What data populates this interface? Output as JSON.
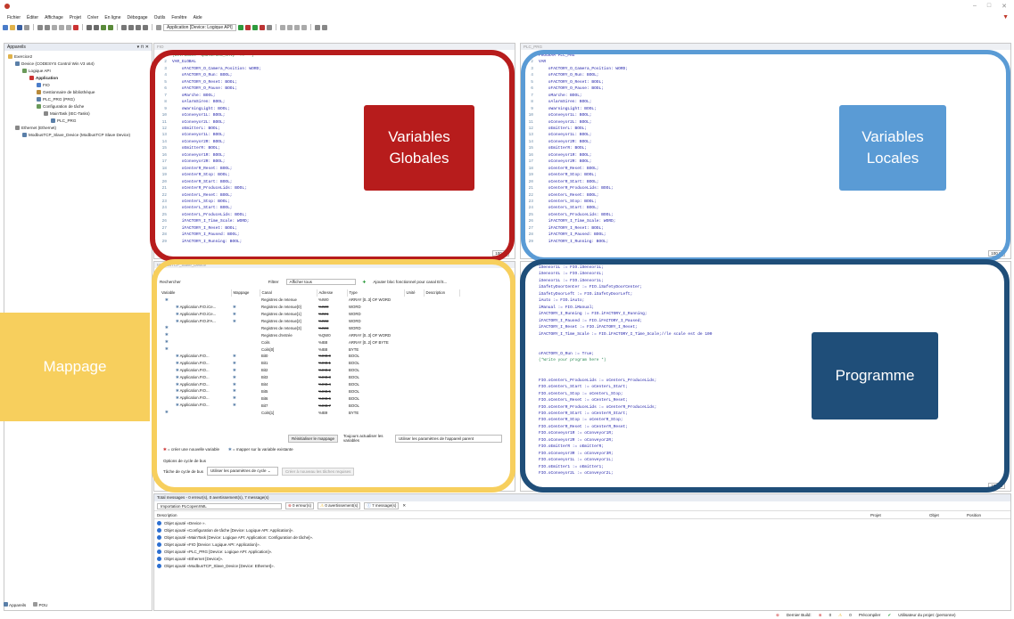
{
  "menu": [
    "Fichier",
    "Éditer",
    "Affichage",
    "Projet",
    "Créer",
    "En ligne",
    "Débogage",
    "Outils",
    "Fenêtre",
    "Aide"
  ],
  "toolbar": {
    "app_combo": "Application [Device: Logique API]"
  },
  "devices": {
    "title": "Appareils",
    "tree": [
      {
        "label": "Exercice2",
        "indent": 0
      },
      {
        "label": "Device (CODESYS Control Win V3 x64)",
        "indent": 1
      },
      {
        "label": "Logique API",
        "indent": 2
      },
      {
        "label": "Application",
        "indent": 3
      },
      {
        "label": "FIO",
        "indent": 4
      },
      {
        "label": "Gestionnaire de bibliothèque",
        "indent": 4
      },
      {
        "label": "PLC_PRG (PRG)",
        "indent": 4
      },
      {
        "label": "Configuration de tâche",
        "indent": 4
      },
      {
        "label": "MainTask (IEC-Tasks)",
        "indent": 5
      },
      {
        "label": "PLC_PRG",
        "indent": 6
      },
      {
        "label": "Ethernet (Ethernet)",
        "indent": 1
      },
      {
        "label": "ModbusTCP_Slave_Device (ModbusTCP Slave Device)",
        "indent": 2
      }
    ],
    "bottom_tabs": [
      "Appareils",
      "POU"
    ]
  },
  "pane_gvl": {
    "tab": "FIO",
    "zoom": "100 %",
    "lines": [
      {
        "n": "1",
        "t": "{attribute 'qualified_only' := ''}",
        "c": true
      },
      {
        "n": "2",
        "t": "VAR_GLOBAL"
      },
      {
        "n": "3",
        "t": "    oFACTORY_O_Camera_Position: WORD;"
      },
      {
        "n": "4",
        "t": "    oFACTORY_O_Run: BOOL;"
      },
      {
        "n": "5",
        "t": "    oFACTORY_O_Reset: BOOL;"
      },
      {
        "n": "6",
        "t": "    oFACTORY_O_Pause: BOOL;"
      },
      {
        "n": "7",
        "t": "    oMarche: BOOL;"
      },
      {
        "n": "8",
        "t": "    oAlarmSiren: BOOL;"
      },
      {
        "n": "9",
        "t": "    oWarningLight: BOOL;"
      },
      {
        "n": "10",
        "t": "    oConveyor1L: BOOL;"
      },
      {
        "n": "11",
        "t": "    oConveyor2L: BOOL;"
      },
      {
        "n": "12",
        "t": "    oEmitterL: BOOL;"
      },
      {
        "n": "13",
        "t": "    oConveyor1L: BOOL;"
      },
      {
        "n": "14",
        "t": "    oConveyor2R: BOOL;"
      },
      {
        "n": "15",
        "t": "    oEmitterR: BOOL;"
      },
      {
        "n": "16",
        "t": "    oConveyor1R: BOOL;"
      },
      {
        "n": "17",
        "t": "    oConveyor2R: BOOL;"
      },
      {
        "n": "18",
        "t": "    oCenterR_Reset: BOOL;"
      },
      {
        "n": "19",
        "t": "    oCenterR_Stop: BOOL;"
      },
      {
        "n": "20",
        "t": "    oCenterR_Start: BOOL;"
      },
      {
        "n": "21",
        "t": "    oCenterR_ProduceLids: BOOL;"
      },
      {
        "n": "22",
        "t": "    oCenterL_Reset: BOOL;"
      },
      {
        "n": "23",
        "t": "    oCenterL_Stop: BOOL;"
      },
      {
        "n": "24",
        "t": "    oCenterL_Start: BOOL;"
      },
      {
        "n": "25",
        "t": "    oCenterL_ProduceLids: BOOL;"
      },
      {
        "n": "26",
        "t": "    iFACTORY_I_Time_Scale: WORD;"
      },
      {
        "n": "27",
        "t": "    iFACTORY_I_Reset: BOOL;"
      },
      {
        "n": "28",
        "t": "    iFACTORY_I_Paused: BOOL;"
      },
      {
        "n": "29",
        "t": "    iFACTORY_I_Running: BOOL;"
      }
    ]
  },
  "pane_prg_vars": {
    "tab": "PLC_PRG",
    "zoom": "100 %",
    "lines": [
      {
        "n": "1",
        "t": "PROGRAM PLC_PRG"
      },
      {
        "n": "2",
        "t": "VAR"
      },
      {
        "n": "3",
        "t": "    oFACTORY_O_Camera_Position: WORD;"
      },
      {
        "n": "4",
        "t": "    oFACTORY_O_Run: BOOL;"
      },
      {
        "n": "5",
        "t": "    oFACTORY_O_Reset: BOOL;"
      },
      {
        "n": "6",
        "t": "    oFACTORY_O_Pause: BOOL;"
      },
      {
        "n": "7",
        "t": "    oMarche: BOOL;"
      },
      {
        "n": "8",
        "t": "    oAlarmSiren: BOOL;"
      },
      {
        "n": "9",
        "t": "    oWarningLight: BOOL;"
      },
      {
        "n": "10",
        "t": "    oConveyor1L: BOOL;"
      },
      {
        "n": "11",
        "t": "    oConveyor2L: BOOL;"
      },
      {
        "n": "12",
        "t": "    oEmitterL: BOOL;"
      },
      {
        "n": "13",
        "t": "    oConveyor1L: BOOL;"
      },
      {
        "n": "14",
        "t": "    oConveyor2R: BOOL;"
      },
      {
        "n": "15",
        "t": "    oEmitterR: BOOL;"
      },
      {
        "n": "16",
        "t": "    oConveyor1R: BOOL;"
      },
      {
        "n": "17",
        "t": "    oConveyor2R: BOOL;"
      },
      {
        "n": "18",
        "t": "    oCenterR_Reset: BOOL;"
      },
      {
        "n": "19",
        "t": "    oCenterR_Stop: BOOL;"
      },
      {
        "n": "20",
        "t": "    oCenterR_Start: BOOL;"
      },
      {
        "n": "21",
        "t": "    oCenterR_ProduceLids: BOOL;"
      },
      {
        "n": "22",
        "t": "    oCenterL_Reset: BOOL;"
      },
      {
        "n": "23",
        "t": "    oCenterL_Stop: BOOL;"
      },
      {
        "n": "24",
        "t": "    oCenterL_Start: BOOL;"
      },
      {
        "n": "25",
        "t": "    oCenterL_ProduceLids: BOOL;"
      },
      {
        "n": "26",
        "t": "    iFACTORY_I_Time_Scale: WORD;"
      },
      {
        "n": "27",
        "t": "    iFACTORY_I_Reset: BOOL;"
      },
      {
        "n": "28",
        "t": "    iFACTORY_I_Paused: BOOL;"
      },
      {
        "n": "29",
        "t": "    iFACTORY_I_Running: BOOL;"
      }
    ]
  },
  "pane_program": {
    "zoom": "100 %",
    "lines": [
      {
        "n": "",
        "t": "iSensor1L := FIO.iSensor1L;"
      },
      {
        "n": "",
        "t": "iSensor4L := FIO.iSensor4L;"
      },
      {
        "n": "",
        "t": "iSensor1L := FIO.iSensor1L;"
      },
      {
        "n": "",
        "t": "iSafetyDoorCenter := FIO.iSafetyDoorCenter;"
      },
      {
        "n": "",
        "t": "iSafetyDoorLeft := FIO.iSafetyDoorLeft;"
      },
      {
        "n": "",
        "t": "iAuto := FIO.iAuto;"
      },
      {
        "n": "",
        "t": "iManual := FIO.iManual;"
      },
      {
        "n": "",
        "t": "iFACTORY_I_Running := FIO.iFACTORY_I_Running;"
      },
      {
        "n": "",
        "t": "iFACTORY_I_Paused := FIO.iFACTORY_I_Paused;"
      },
      {
        "n": "",
        "t": "iFACTORY_I_Reset := FIO.iFACTORY_I_Reset;"
      },
      {
        "n": "",
        "t": "iFACTORY_I_Time_Scale := FIO.iFACTORY_I_Time_Scale;//le scale est de 100"
      },
      {
        "n": "",
        "t": ""
      },
      {
        "n": "",
        "t": ""
      },
      {
        "n": "",
        "t": "oFACTORY_O_Run := True;"
      },
      {
        "n": "",
        "t": "(*Write your program here *)",
        "c": true
      },
      {
        "n": "",
        "t": ""
      },
      {
        "n": "",
        "t": ""
      },
      {
        "n": "",
        "t": "FIO.oCenterL_ProduceLids := oCenterL_ProduceLids;"
      },
      {
        "n": "",
        "t": "FIO.oCenterL_Start := oCenterL_Start;"
      },
      {
        "n": "",
        "t": "FIO.oCenterL_Stop := oCenterL_Stop;"
      },
      {
        "n": "",
        "t": "FIO.oCenterL_Reset := oCenterL_Reset;"
      },
      {
        "n": "",
        "t": "FIO.oCenterR_ProduceLids := oCenterR_ProduceLids;"
      },
      {
        "n": "",
        "t": "FIO.oCenterR_Start := oCenterR_Start;"
      },
      {
        "n": "",
        "t": "FIO.oCenterR_Stop := oCenterR_Stop;"
      },
      {
        "n": "",
        "t": "FIO.oCenterR_Reset := oCenterR_Reset;"
      },
      {
        "n": "",
        "t": "FIO.oConveyor1R := oConveyor1R;"
      },
      {
        "n": "",
        "t": "FIO.oConveyor2R := oConveyor2R;"
      },
      {
        "n": "",
        "t": "FIO.oEmitterR := oEmitterR;"
      },
      {
        "n": "",
        "t": "FIO.oConveyor3R := oConveyor3R;"
      },
      {
        "n": "",
        "t": "FIO.oConveyor1L := oConveyor1L;"
      },
      {
        "n": "",
        "t": "FIO.oEmitter1 := oEmitter1;"
      },
      {
        "n": "",
        "t": "FIO.oConveyor2L := oConveyor2L;"
      }
    ]
  },
  "mapping": {
    "tab": "ModbusTCP_Slave_Device",
    "search_label": "Rechercher",
    "filter_label": "Filtrer",
    "filter_value": "Afficher tous",
    "add_fb": "Ajouter bloc fonctionnel pour canal E/S...",
    "headers": [
      "Variable",
      "Mappage",
      "Canal",
      "Adresse",
      "Type",
      "Unité",
      "Description"
    ],
    "rows": [
      {
        "var": "",
        "canal": "Registres de retenue",
        "addr": "%IW0",
        "type": "ARRAY [0..3] OF WORD",
        "strike": false
      },
      {
        "var": "Application.FIO.iCe...",
        "canal": "Registres de retenue[0]",
        "addr": "%IW0",
        "type": "WORD",
        "strike": true
      },
      {
        "var": "Application.FIO.iCe...",
        "canal": "Registres de retenue[1]",
        "addr": "%IW1",
        "type": "WORD",
        "strike": true
      },
      {
        "var": "Application.FIO.iFA...",
        "canal": "Registres de retenue[2]",
        "addr": "%IW2",
        "type": "WORD",
        "strike": true
      },
      {
        "var": "",
        "canal": "Registres de retenue[3]",
        "addr": "%IW3",
        "type": "WORD",
        "strike": true
      },
      {
        "var": "",
        "canal": "Registres d'entrée",
        "addr": "%QW0",
        "type": "ARRAY [0..3] OF WORD",
        "strike": false
      },
      {
        "var": "",
        "canal": "Coils",
        "addr": "%IB8",
        "type": "ARRAY [0..2] OF BYTE",
        "strike": false
      },
      {
        "var": "",
        "canal": "Coils[0]",
        "addr": "%IB8",
        "type": "BYTE",
        "strike": false
      },
      {
        "var": "Application.FIO...",
        "canal": "Bit0",
        "addr": "%IX8.0",
        "type": "BOOL",
        "strike": true
      },
      {
        "var": "Application.FIO...",
        "canal": "Bit1",
        "addr": "%IX8.1",
        "type": "BOOL",
        "strike": true
      },
      {
        "var": "Application.FIO...",
        "canal": "Bit2",
        "addr": "%IX8.2",
        "type": "BOOL",
        "strike": true
      },
      {
        "var": "Application.FIO...",
        "canal": "Bit3",
        "addr": "%IX8.3",
        "type": "BOOL",
        "strike": true
      },
      {
        "var": "Application.FIO...",
        "canal": "Bit4",
        "addr": "%IX8.4",
        "type": "BOOL",
        "strike": true
      },
      {
        "var": "Application.FIO...",
        "canal": "Bit5",
        "addr": "%IX8.5",
        "type": "BOOL",
        "strike": true
      },
      {
        "var": "Application.FIO...",
        "canal": "Bit6",
        "addr": "%IX8.6",
        "type": "BOOL",
        "strike": true
      },
      {
        "var": "Application.FIO...",
        "canal": "Bit7",
        "addr": "%IX8.7",
        "type": "BOOL",
        "strike": true
      },
      {
        "var": "",
        "canal": "Coils[1]",
        "addr": "%IB9",
        "type": "BYTE",
        "strike": false
      }
    ],
    "reset_mapping": "Réinitialiser le mappage",
    "always_update": "Toujours actualiser les variables",
    "use_parent": "Utiliser les paramètres de l'appareil parent",
    "legend_new": "= créer une nouvelle variable",
    "legend_map": "= mapper sur la variable existante",
    "bus_cycle_title": "Options de cycle de bus",
    "bus_cycle_task": "Tâche de cycle de bus",
    "bus_cycle_value": "Utiliser les paramètres de cycle",
    "create_task": "Créer à nouveau les tâches requises"
  },
  "overlays": {
    "globals": {
      "label": "Variables Globales",
      "color": "#b71c1c"
    },
    "locals": {
      "label": "Variables Locales",
      "color": "#5a9bd5"
    },
    "mapping": {
      "label": "Mappage",
      "color": "#f7cf5d"
    },
    "program": {
      "label": "Programme",
      "color": "#1f4e79"
    }
  },
  "messages": {
    "summary": "Total messages - 0 erreur(s), 0 avertissement(s), 7 message(s)",
    "source": "Importation PLCopenXML",
    "errors": "0 erreur(s)",
    "warnings": "0 avertissement(s)",
    "infos": "7 message(s)",
    "headers": [
      "Description",
      "Projet",
      "Objet",
      "Position"
    ],
    "rows": [
      "Objet ajouté «Device ».",
      "Objet ajouté «Configuration de tâche [Device: Logique API: Application]».",
      "Objet ajouté «MainTask [Device: Logique API: Application: Configuration de tâche]».",
      "Objet ajouté «FIO [Device: Logique API: Application]».",
      "Objet ajouté «PLC_PRG [Device: Logique API: Application]».",
      "Objet ajouté «Ethernet [Device]».",
      "Objet ajouté «ModbusTCP_Slave_Device [Device: Ethernet]»."
    ]
  },
  "status": {
    "build": "Dernier Build:",
    "errs": "0",
    "warns": "0",
    "precompile": "Précompiler",
    "user": "Utilisateur du projet: (personne)"
  }
}
